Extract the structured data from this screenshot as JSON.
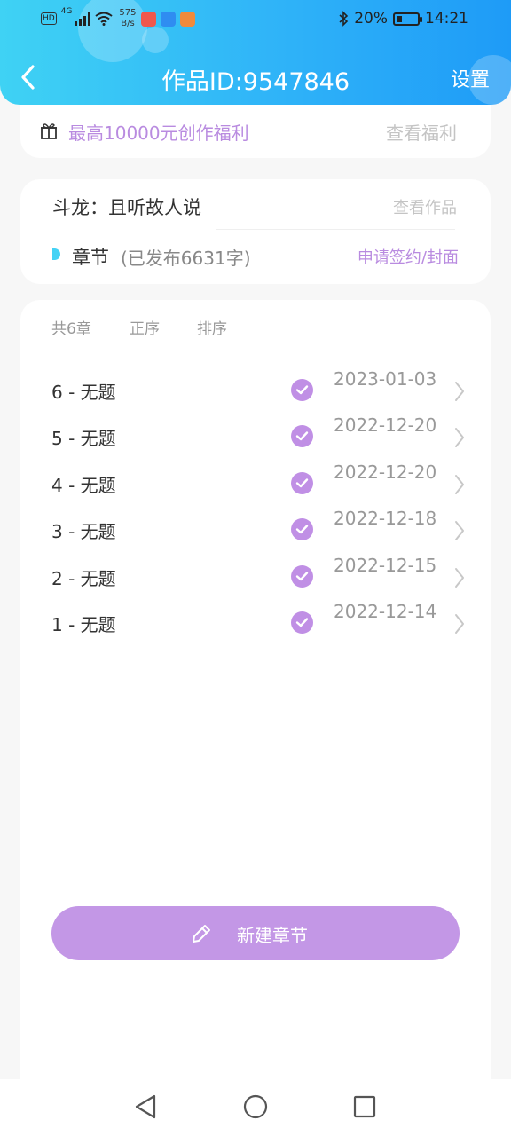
{
  "status_bar": {
    "hd": "HD",
    "network": "4G",
    "speed_value": "575",
    "speed_unit": "B/s",
    "battery": "20%",
    "time": "14:21",
    "app_icon_colors": [
      "#f0574c",
      "#2f8df1",
      "#f08a3c"
    ]
  },
  "header": {
    "title": "作品ID:9547846",
    "settings_label": "设置",
    "back_icon": "chevron-left-icon"
  },
  "welfare": {
    "icon": "gift-icon",
    "text": "最高10000元创作福利",
    "link": "查看福利"
  },
  "work": {
    "title": "斗龙：且听故人说",
    "view_link": "查看作品",
    "chapter_label": "章节",
    "chapter_summary": "(已发布6631字)",
    "apply_link": "申请签约/封面"
  },
  "toolbar": {
    "count": "共6章",
    "order": "正序",
    "sort": "排序"
  },
  "chapters": [
    {
      "title": "6 - 无题",
      "date": "2023-01-03",
      "published": true
    },
    {
      "title": "5 - 无题",
      "date": "2022-12-20",
      "published": true
    },
    {
      "title": "4 - 无题",
      "date": "2022-12-20",
      "published": true
    },
    {
      "title": "3 - 无题",
      "date": "2022-12-18",
      "published": true
    },
    {
      "title": "2 - 无题",
      "date": "2022-12-15",
      "published": true
    },
    {
      "title": "1 - 无题",
      "date": "2022-12-14",
      "published": true
    }
  ],
  "new_chapter": {
    "label": "新建章节",
    "icon": "pencil-icon"
  },
  "colors": {
    "accent_purple": "#c397e6",
    "accent_text_purple": "#b98be0",
    "header_cyan": "#3fd2f4",
    "header_blue": "#1e9bf7",
    "chapter_dot": "#44d2f5"
  }
}
